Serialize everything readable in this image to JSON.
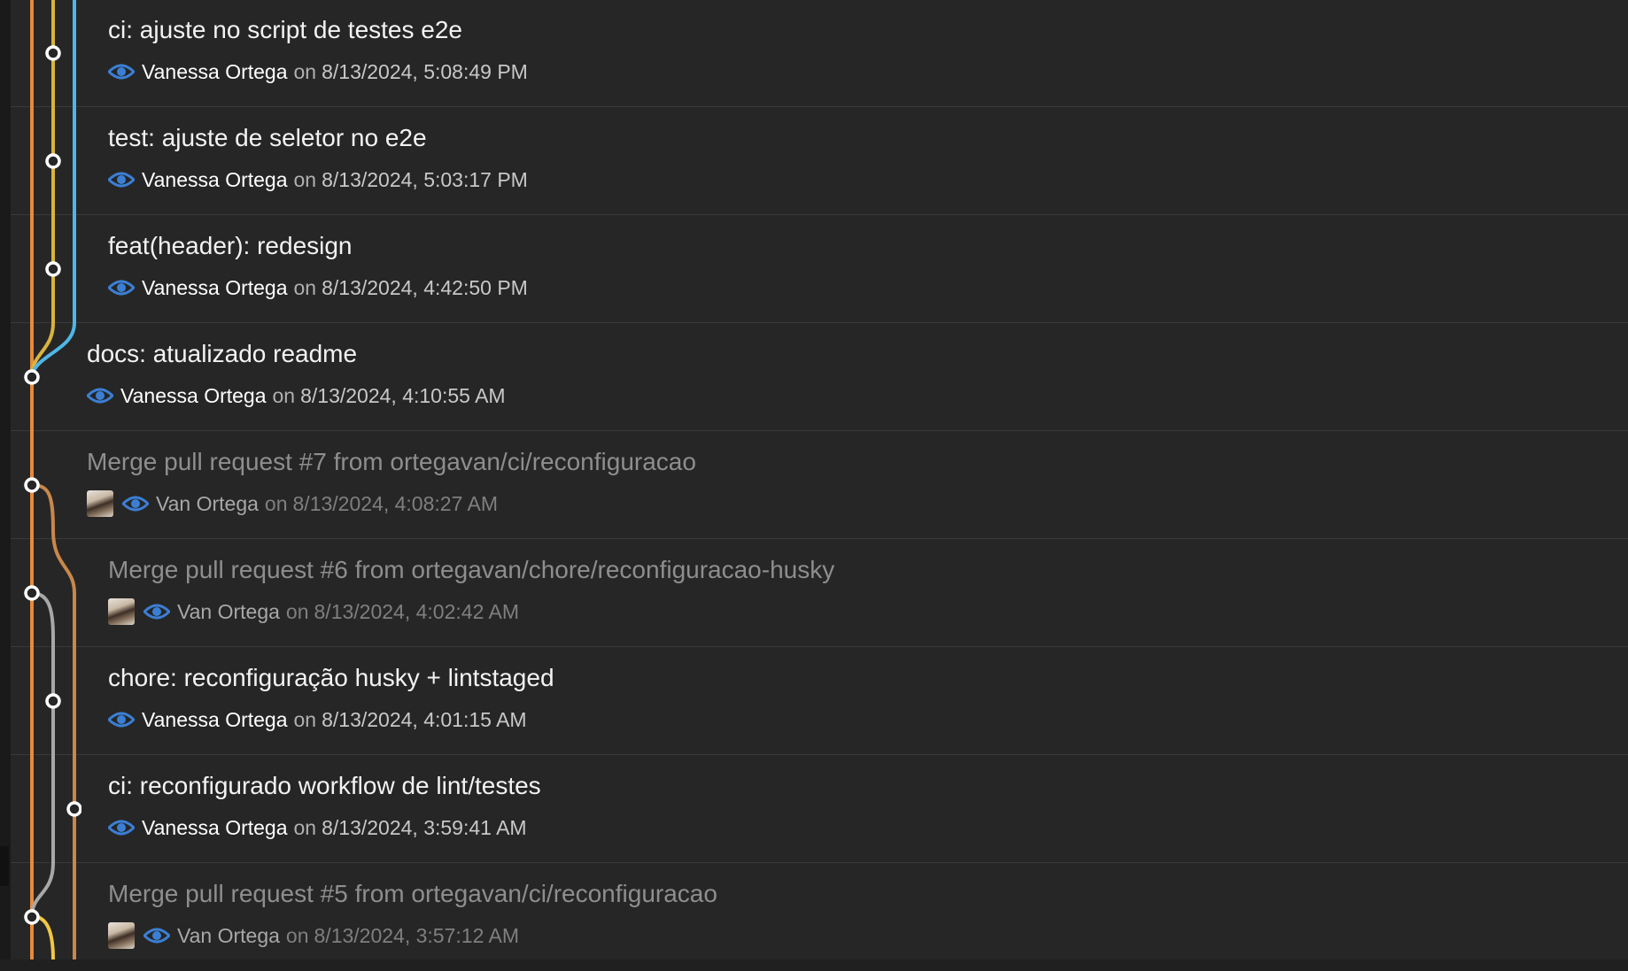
{
  "commits": [
    {
      "message": "ci: ajuste no script de testes e2e",
      "author": "Vanessa Ortega",
      "on": "on",
      "date": "8/13/2024, 5:08:49 PM",
      "avatar": false,
      "dim": false
    },
    {
      "message": "test: ajuste de seletor no e2e",
      "author": "Vanessa Ortega",
      "on": "on",
      "date": "8/13/2024, 5:03:17 PM",
      "avatar": false,
      "dim": false
    },
    {
      "message": "feat(header): redesign",
      "author": "Vanessa Ortega",
      "on": "on",
      "date": "8/13/2024, 4:42:50 PM",
      "avatar": false,
      "dim": false
    },
    {
      "message": "docs: atualizado readme",
      "author": "Vanessa Ortega",
      "on": "on",
      "date": "8/13/2024, 4:10:55 AM",
      "avatar": false,
      "dim": false
    },
    {
      "message": "Merge pull request #7 from ortegavan/ci/reconfiguracao",
      "author": "Van Ortega",
      "on": "on",
      "date": "8/13/2024, 4:08:27 AM",
      "avatar": true,
      "dim": true
    },
    {
      "message": "Merge pull request #6 from ortegavan/chore/reconfiguracao-husky",
      "author": "Van Ortega",
      "on": "on",
      "date": "8/13/2024, 4:02:42 AM",
      "avatar": true,
      "dim": true
    },
    {
      "message": "chore: reconfiguração husky + lintstaged",
      "author": "Vanessa Ortega",
      "on": "on",
      "date": "8/13/2024, 4:01:15 AM",
      "avatar": false,
      "dim": false
    },
    {
      "message": "ci: reconfigurado workflow de lint/testes",
      "author": "Vanessa Ortega",
      "on": "on",
      "date": "8/13/2024, 3:59:41 AM",
      "avatar": false,
      "dim": false
    },
    {
      "message": "Merge pull request #5 from ortegavan/ci/reconfiguracao",
      "author": "Van Ortega",
      "on": "on",
      "date": "8/13/2024, 3:57:12 AM",
      "avatar": true,
      "dim": true
    }
  ],
  "colors": {
    "lane_orange": "#e88a3a",
    "lane_yellow": "#d9b43c",
    "lane_blue": "#4fb6e6",
    "lane_brown": "#c9874a",
    "lane_gray": "#a8a8a8",
    "lane_bright_yellow": "#f2c744",
    "eye_icon": "#3b7fd4"
  }
}
